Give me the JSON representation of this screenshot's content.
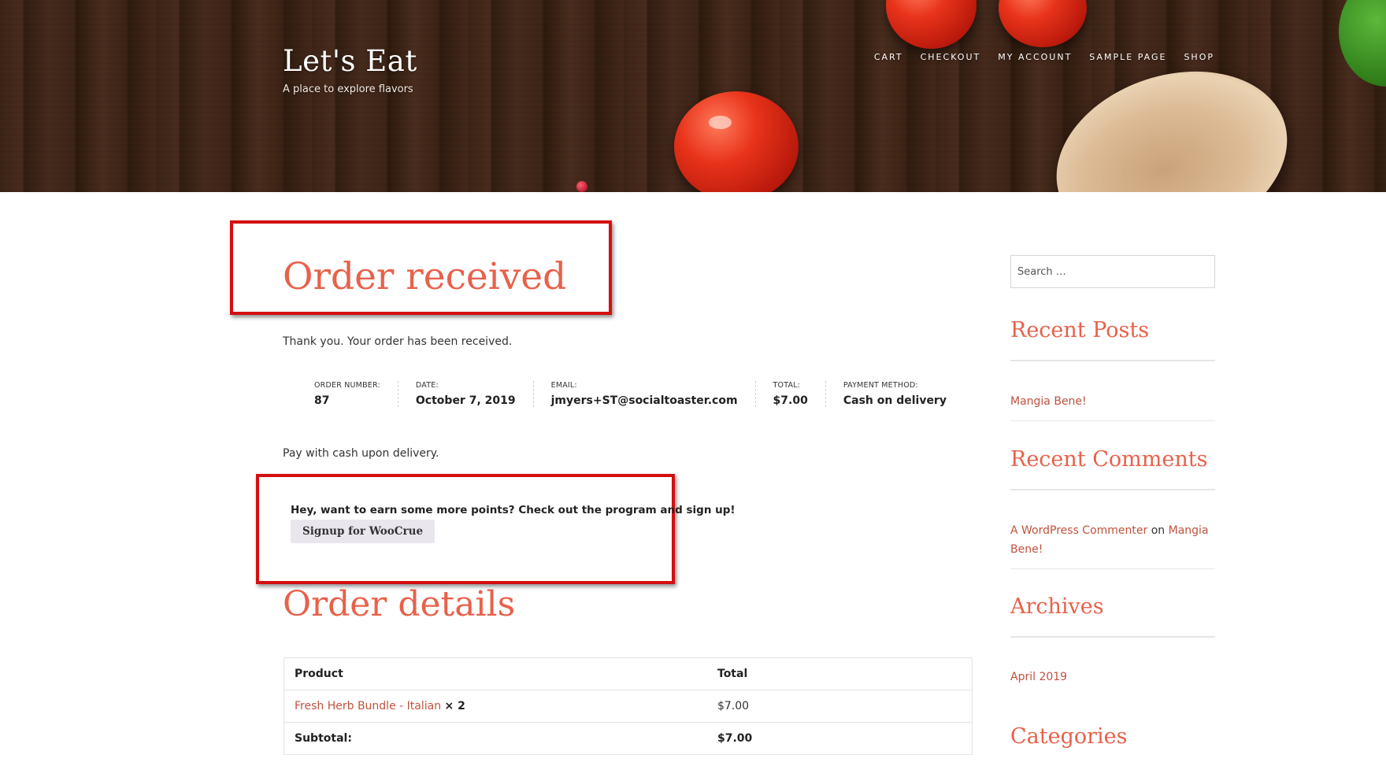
{
  "header": {
    "site_title": "Let's Eat",
    "tagline": "A place to explore flavors",
    "nav": [
      "CART",
      "CHECKOUT",
      "MY ACCOUNT",
      "SAMPLE PAGE",
      "SHOP"
    ]
  },
  "main": {
    "page_title": "Order received",
    "thank_you": "Thank you. Your order has been received.",
    "overview": [
      {
        "label": "ORDER NUMBER:",
        "value": "87"
      },
      {
        "label": "DATE:",
        "value": "October 7, 2019"
      },
      {
        "label": "EMAIL:",
        "value": "jmyers+ST@socialtoaster.com"
      },
      {
        "label": "TOTAL:",
        "value": "$7.00"
      },
      {
        "label": "PAYMENT METHOD:",
        "value": "Cash on delivery"
      }
    ],
    "payment_note": "Pay with cash upon delivery.",
    "points_promo": "Hey, want to earn some more points? Check out the program and sign up!",
    "signup_button": "Signup for WooCrue",
    "order_details_title": "Order details",
    "table": {
      "headers": [
        "Product",
        "Total"
      ],
      "item": {
        "name": "Fresh Herb Bundle - Italian",
        "qty": "× 2",
        "total": "$7.00"
      },
      "subtotal_label": "Subtotal:",
      "subtotal_value": "$7.00"
    }
  },
  "sidebar": {
    "search_placeholder": "Search …",
    "recent_posts_title": "Recent Posts",
    "recent_post": "Mangia Bene!",
    "recent_comments_title": "Recent Comments",
    "comment_author": "A WordPress Commenter",
    "comment_on": "on",
    "comment_post": "Mangia Bene!",
    "archives_title": "Archives",
    "archive_item": "April 2019",
    "categories_title": "Categories"
  },
  "colors": {
    "accent": "#e8614a",
    "link": "#c0523e",
    "annotation_box": "#d40f0f"
  }
}
